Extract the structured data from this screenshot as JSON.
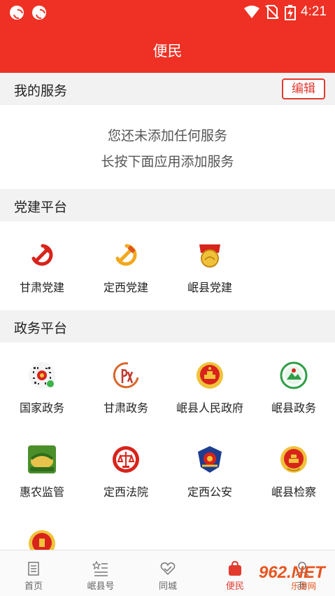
{
  "status_bar": {
    "time": "4:21"
  },
  "header": {
    "title": "便民"
  },
  "my_services": {
    "title": "我的服务",
    "edit_label": "编辑",
    "empty_line1": "您还未添加任何服务",
    "empty_line2": "长按下面应用添加服务"
  },
  "party_platform": {
    "title": "党建平台",
    "items": [
      {
        "label": "甘肃党建",
        "icon": "party-emblem-icon"
      },
      {
        "label": "定西党建",
        "icon": "party-emblem-icon"
      },
      {
        "label": "岷县党建",
        "icon": "party-badge-icon"
      }
    ]
  },
  "gov_platform": {
    "title": "政务平台",
    "items": [
      {
        "label": "国家政务",
        "icon": "qr-code-icon"
      },
      {
        "label": "甘肃政务",
        "icon": "gansu-gov-logo-icon"
      },
      {
        "label": "岷县人民政府",
        "icon": "national-emblem-icon"
      },
      {
        "label": "岷县政务",
        "icon": "minxian-gov-logo-icon"
      },
      {
        "label": "惠农监管",
        "icon": "huinong-logo-icon"
      },
      {
        "label": "定西法院",
        "icon": "court-emblem-icon"
      },
      {
        "label": "定西公安",
        "icon": "police-emblem-icon"
      },
      {
        "label": "岷县检察",
        "icon": "procuratorate-emblem-icon"
      },
      {
        "label": "",
        "icon": "emblem-icon"
      }
    ]
  },
  "bottom_nav": {
    "items": [
      {
        "label": "首页",
        "icon": "home-icon"
      },
      {
        "label": "岷县号",
        "icon": "stars-list-icon"
      },
      {
        "label": "同城",
        "icon": "heart-hands-icon"
      },
      {
        "label": "便民",
        "icon": "bag-icon",
        "active": true
      },
      {
        "label": "我",
        "icon": "user-icon"
      }
    ]
  },
  "watermark": {
    "text": "962.NET",
    "sub": "乐游网"
  },
  "colors": {
    "brand_red": "#ee3124",
    "section_bg": "#f2f2f2",
    "gold": "#f6c02c"
  }
}
